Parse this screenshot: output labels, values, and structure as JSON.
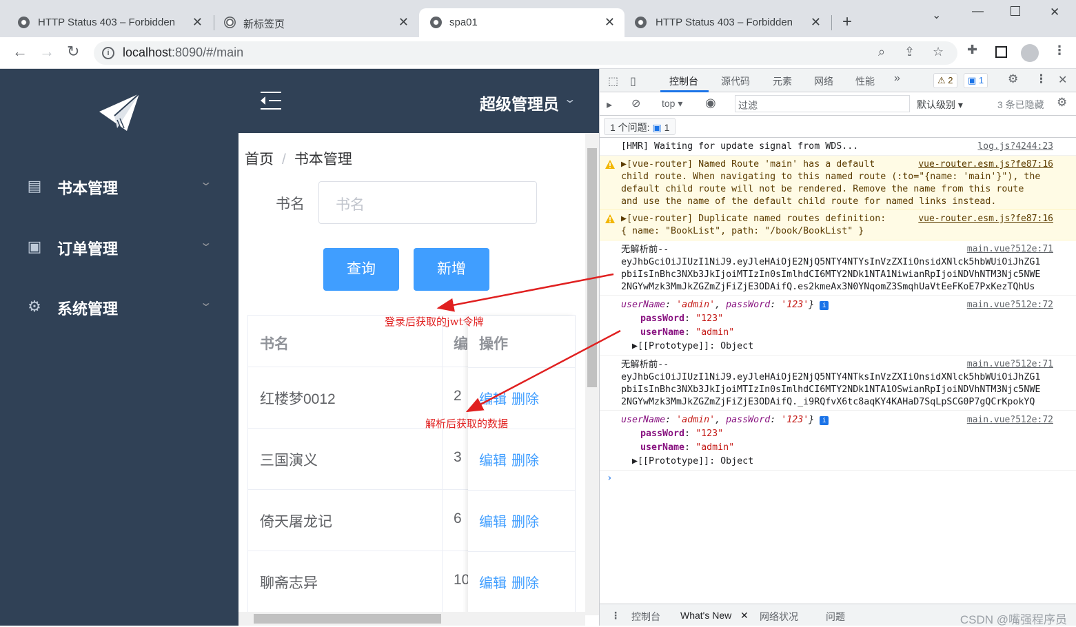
{
  "browser": {
    "tabs": [
      {
        "title": "HTTP Status 403 – Forbidden",
        "icon": "globe-icon"
      },
      {
        "title": "新标签页",
        "icon": "chrome-icon"
      },
      {
        "title": "spa01",
        "icon": "globe-icon"
      },
      {
        "title": "HTTP Status 403 – Forbidden",
        "icon": "globe-icon"
      }
    ],
    "active_tab": 2,
    "url_host": "localhost",
    "url_rest": ":8090/#/main"
  },
  "app": {
    "sidebar": [
      {
        "label": "书本管理",
        "icon": "document-icon"
      },
      {
        "label": "订单管理",
        "icon": "clipboard-icon"
      },
      {
        "label": "系统管理",
        "icon": "gear-icon"
      }
    ],
    "user_label": "超级管理员",
    "breadcrumb": [
      "首页",
      "书本管理"
    ],
    "breadcrumb_sep": "/",
    "search_label": "书名",
    "search_placeholder": "书名",
    "query_button": "查询",
    "add_button": "新增",
    "table": {
      "headers": [
        "书名",
        "编",
        "操作"
      ],
      "rows": [
        {
          "name": "红楼梦0012",
          "id": "2",
          "edit": "编辑",
          "delete": "删除"
        },
        {
          "name": "三国演义",
          "id": "3",
          "edit": "编辑",
          "delete": "删除"
        },
        {
          "name": "倚天屠龙记",
          "id": "6",
          "edit": "编辑",
          "delete": "删除"
        },
        {
          "name": "聊斋志异",
          "id": "10",
          "edit": "编辑",
          "delete": "删除"
        }
      ]
    },
    "annotations": {
      "jwt_note": "登录后获取的jwt令牌",
      "parsed_note": "解析后获取的数据"
    }
  },
  "devtools": {
    "tabs": [
      "控制台",
      "源代码",
      "元素",
      "网络",
      "性能"
    ],
    "warn_count": "2",
    "issue_count": "1",
    "context": "top",
    "filter_placeholder": "过滤",
    "levels": "默认级别",
    "hidden": "3 条已隐藏",
    "issues_label": "1 个问题:",
    "issues_num": "1",
    "console": {
      "hmr": {
        "text": "[HMR] Waiting for update signal from WDS...",
        "src": "log.js?4244:23"
      },
      "warn1": {
        "lines": [
          "▶[vue-router] Named Route 'main' has a default",
          "child route. When navigating to this named route (:to=\"{name: 'main'}\"), the",
          "default child route will not be rendered. Remove the name from this route",
          "and use the name of the default child route for named links instead."
        ],
        "src": "vue-router.esm.js?fe87:16"
      },
      "warn2": {
        "lines": [
          "▶[vue-router] Duplicate named routes definition:",
          "{ name: \"BookList\", path: \"/book/BookList\" }"
        ],
        "src": "vue-router.esm.js?fe87:16"
      },
      "jwt1": {
        "lines": [
          "无解析前--",
          "eyJhbGciOiJIUzI1NiJ9.eyJleHAiOjE2NjQ5NTY4NTYsInVzZXIiOnsidXNlck5hbWUiOiJhZG1",
          "pbiIsInBhc3NXb3JkIjoiMTIzIn0sImlhdCI6MTY2NDk1NTA1NiwianRpIjoiNDVhNTM3Njc5NWE",
          "2NGYwMzk3MmJkZGZmZjFiZjE3ODAifQ.es2kmeAx3N0YNqomZ3SmqhUaVtEeFKoE7PxKezTQhUs"
        ],
        "src": "main.vue?512e:71"
      },
      "obj1": {
        "summary_user_key": "userName",
        "summary_user_val": "'admin'",
        "summary_pass_key": "passWord",
        "summary_pass_val": "'123'",
        "pass_key": "passWord",
        "pass_val": "\"123\"",
        "user_key": "userName",
        "user_val": "\"admin\"",
        "proto": "[[Prototype]]: Object",
        "src": "main.vue?512e:72"
      },
      "jwt2": {
        "lines": [
          "无解析前--",
          "eyJhbGciOiJIUzI1NiJ9.eyJleHAiOjE2NjQ5NTY4NTksInVzZXIiOnsidXNlck5hbWUiOiJhZG1",
          "pbiIsInBhc3NXb3JkIjoiMTIzIn0sImlhdCI6MTY2NDk1NTA1OSwianRpIjoiNDVhNTM3Njc5NWE",
          "2NGYwMzk3MmJkZGZmZjFiZjE3ODAifQ._i9RQfvX6tc8aqKY4KAHaD7SqLpSCG0P7gQCrKpokYQ"
        ],
        "src": "main.vue?512e:71"
      },
      "obj2": {
        "summary_user_key": "userName",
        "summary_user_val": "'admin'",
        "summary_pass_key": "passWord",
        "summary_pass_val": "'123'",
        "pass_key": "passWord",
        "pass_val": "\"123\"",
        "user_key": "userName",
        "user_val": "\"admin\"",
        "proto": "[[Prototype]]: Object",
        "src": "main.vue?512e:72"
      }
    },
    "drawer_tabs": [
      "控制台",
      "What's New",
      "网络状况",
      "问题"
    ],
    "watermark": "CSDN @嘴强程序员"
  },
  "colors": {
    "sidebar": "#304156",
    "primary": "#409eff",
    "annotation": "#e02020"
  }
}
